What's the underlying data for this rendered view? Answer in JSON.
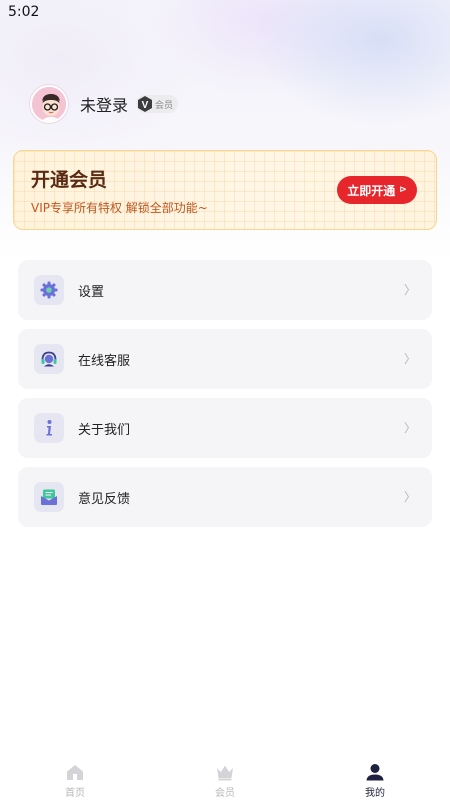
{
  "status_bar": {
    "time": "5:02"
  },
  "profile": {
    "username": "未登录",
    "badge_letter": "V",
    "badge_text": "会员",
    "avatar_icon": "avatar-boy-glasses"
  },
  "vip_card": {
    "title": "开通会员",
    "subtitle": "VIP专享所有特权 解锁全部功能~",
    "button_label": "立即开通",
    "button_arrow": "⊳",
    "accent_color": "#e7262c"
  },
  "menu": {
    "items": [
      {
        "label": "设置",
        "icon": "gear-icon"
      },
      {
        "label": "在线客服",
        "icon": "headset-icon"
      },
      {
        "label": "关于我们",
        "icon": "info-icon"
      },
      {
        "label": "意见反馈",
        "icon": "feedback-icon"
      }
    ],
    "chevron": "〉"
  },
  "tabs": [
    {
      "label": "首页",
      "icon": "home-icon",
      "active": false
    },
    {
      "label": "会员",
      "icon": "crown-icon",
      "active": false
    },
    {
      "label": "我的",
      "icon": "user-icon",
      "active": true
    }
  ]
}
